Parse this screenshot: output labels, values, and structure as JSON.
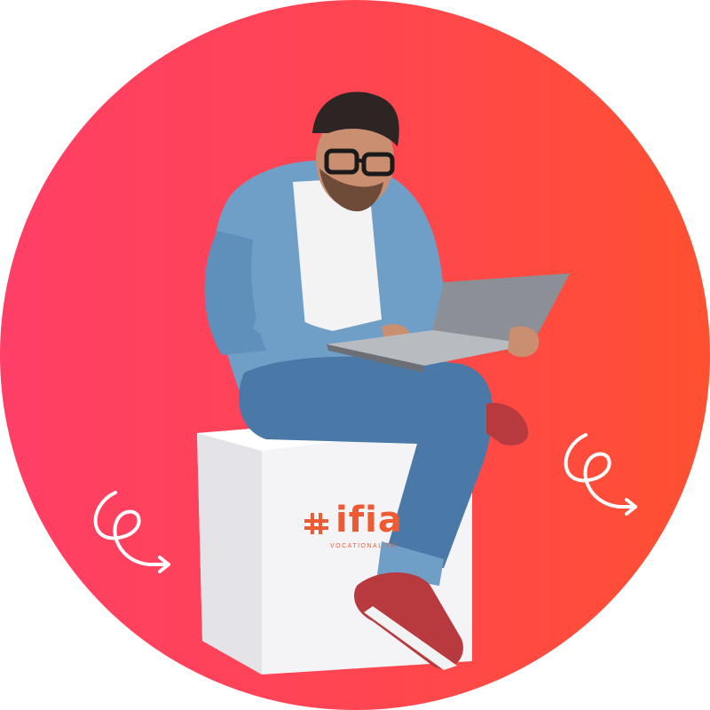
{
  "logo": {
    "text": "ifia",
    "subtitle": "VOCATIONAL TR",
    "icon": "cross-hash-icon"
  },
  "colors": {
    "gradient_start": "#ff3f66",
    "gradient_end": "#ff5030",
    "brand": "#ee5a32",
    "denim": "#6f9fc7"
  },
  "decorations": {
    "left": "curly-arrow-icon",
    "right": "curly-arrow-icon"
  }
}
